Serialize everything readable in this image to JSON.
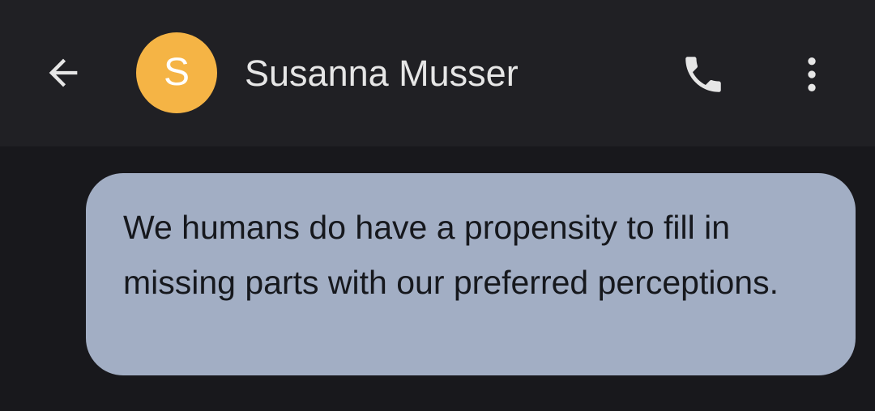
{
  "header": {
    "back_icon": "arrow-left-icon",
    "avatar_initial": "S",
    "avatar_color": "#f5b445",
    "contact_name": "Susanna Musser",
    "call_icon": "phone-icon",
    "more_icon": "more-vertical-icon"
  },
  "messages": [
    {
      "direction": "incoming",
      "text": "We humans do have a propensity to fill in missing parts with our preferred perceptions.",
      "bubble_color": "#a2aec4"
    }
  ],
  "colors": {
    "header_bg": "#202024",
    "thread_bg": "#18181c",
    "header_text": "#e6e6e6"
  }
}
